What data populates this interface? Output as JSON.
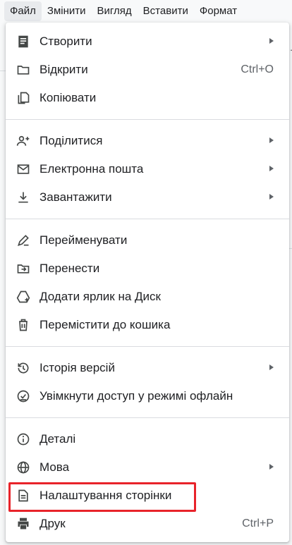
{
  "menubar": {
    "items": [
      "Файл",
      "Змінити",
      "Вигляд",
      "Вставити",
      "Формат"
    ]
  },
  "file_menu": {
    "create": {
      "label": "Створити",
      "icon": "description-icon",
      "submenu": true
    },
    "open": {
      "label": "Відкрити",
      "shortcut": "Ctrl+O",
      "icon": "folder-icon"
    },
    "copy": {
      "label": "Копіювати",
      "icon": "copy-icon"
    },
    "share": {
      "label": "Поділитися",
      "icon": "person-add-icon",
      "submenu": true
    },
    "email": {
      "label": "Електронна пошта",
      "icon": "mail-icon",
      "submenu": true
    },
    "download": {
      "label": "Завантажити",
      "icon": "download-icon",
      "submenu": true
    },
    "rename": {
      "label": "Перейменувати",
      "icon": "rename-icon"
    },
    "move": {
      "label": "Перенести",
      "icon": "drive-file-move-icon"
    },
    "add_shortcut": {
      "label": "Додати ярлик на Диск",
      "icon": "add-to-drive-icon"
    },
    "trash": {
      "label": "Перемістити до кошика",
      "icon": "trash-icon"
    },
    "version_history": {
      "label": "Історія версій",
      "icon": "history-icon",
      "submenu": true
    },
    "offline": {
      "label": "Увімкнути доступ у режимі офлайн",
      "icon": "offline-check-icon"
    },
    "details": {
      "label": "Деталі",
      "icon": "info-icon"
    },
    "language": {
      "label": "Мова",
      "icon": "globe-icon",
      "submenu": true
    },
    "page_setup": {
      "label": "Налаштування сторінки",
      "icon": "page-setup-icon"
    },
    "print": {
      "label": "Друк",
      "shortcut": "Ctrl+P",
      "icon": "print-icon"
    }
  },
  "colors": {
    "highlight": "#e8232a",
    "icon": "#444746"
  }
}
